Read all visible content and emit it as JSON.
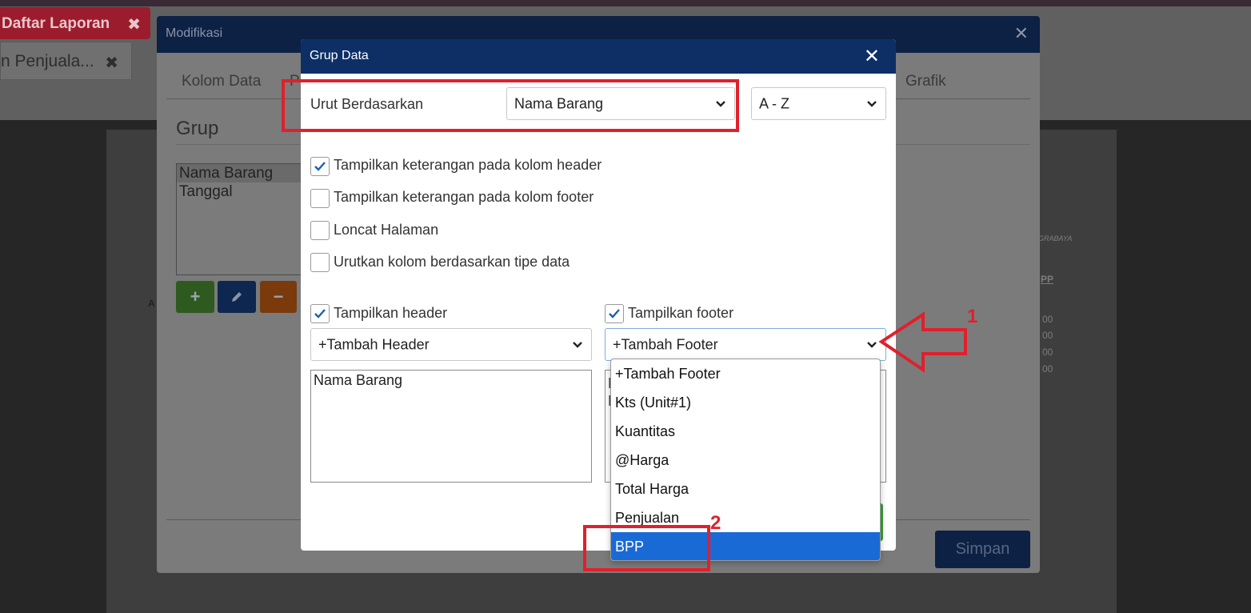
{
  "background": {
    "tab_active": "Daftar Laporan",
    "tab_active_close": "✖",
    "tab_doc": "n Penjuala...",
    "tab_doc_close": "✖",
    "paper_texts": [
      "GRABAYA",
      "PP",
      "00",
      "00",
      "00",
      "00"
    ],
    "paper_left_mark": "A"
  },
  "modifikasi": {
    "title": "Modifikasi",
    "close": "✕",
    "tabs": [
      "Kolom Data",
      "P",
      "Grafik"
    ],
    "section_title": "Grup",
    "group_list": [
      "Nama Barang",
      "Tanggal"
    ],
    "add_btn": "+",
    "edit_icon": "pencil-icon",
    "remove_btn": "−",
    "save_label": "Simpan"
  },
  "grup_data": {
    "title": "Grup Data",
    "close": "✕",
    "sort_label": "Urut Berdasarkan",
    "sort_field": "Nama Barang",
    "sort_order": "A - Z",
    "checkboxes": [
      {
        "label": "Tampilkan keterangan pada kolom header",
        "checked": true
      },
      {
        "label": "Tampilkan keterangan pada kolom footer",
        "checked": false
      },
      {
        "label": "Loncat Halaman",
        "checked": false
      },
      {
        "label": "Urutkan kolom berdasarkan tipe data",
        "checked": false
      }
    ],
    "header": {
      "label": "Tampilkan header",
      "checked": true,
      "select_value": "+Tambah Header",
      "items": [
        "Nama Barang"
      ]
    },
    "footer": {
      "label": "Tampilkan footer",
      "checked": true,
      "select_value": "+Tambah Footer",
      "partial_items": [
        "K",
        "B"
      ]
    },
    "footer_dropdown": {
      "options": [
        "+Tambah Footer",
        "Kts (Unit#1)",
        "Kuantitas",
        "@Harga",
        "Total Harga",
        "Penjualan",
        "BPP"
      ],
      "highlighted": "BPP"
    }
  },
  "annotations": {
    "step1": "1",
    "step2": "2",
    "color": "#e0202c"
  },
  "colors": {
    "header_navy": "#0d2f66",
    "highlight_blue": "#1a6ad6",
    "check_blue": "#1a5fb4"
  }
}
